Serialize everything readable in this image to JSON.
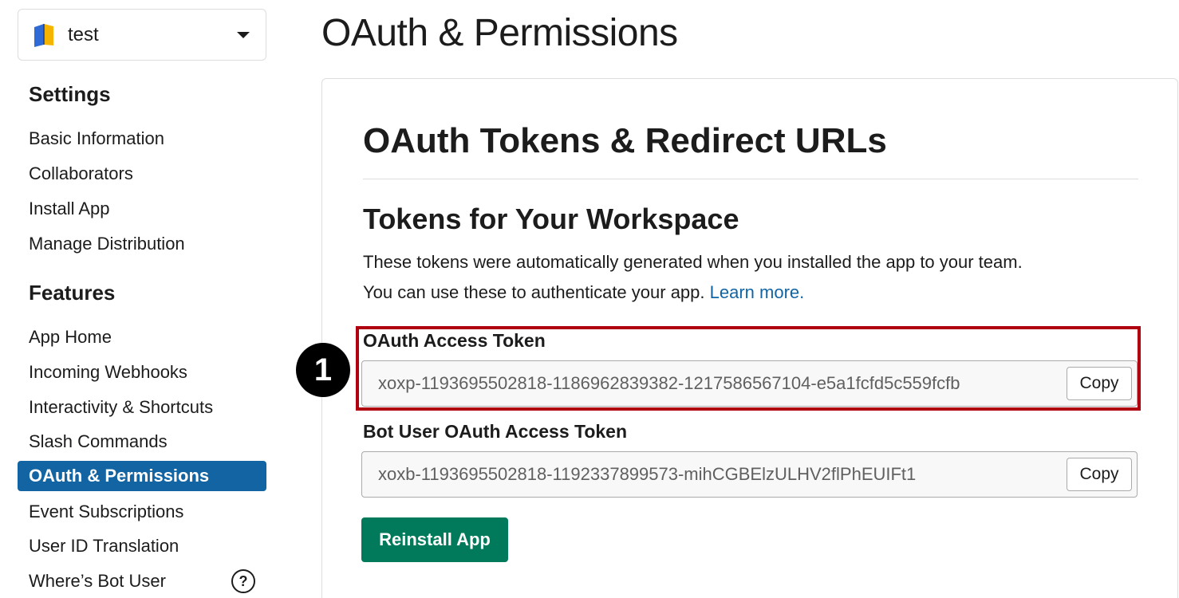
{
  "app_switcher": {
    "name": "test",
    "icon": "book-app-icon"
  },
  "sidebar": {
    "settings_heading": "Settings",
    "settings_items": [
      {
        "label": "Basic Information"
      },
      {
        "label": "Collaborators"
      },
      {
        "label": "Install App"
      },
      {
        "label": "Manage Distribution"
      }
    ],
    "features_heading": "Features",
    "features_items": [
      {
        "label": "App Home"
      },
      {
        "label": "Incoming Webhooks"
      },
      {
        "label": "Interactivity & Shortcuts"
      },
      {
        "label": "Slash Commands"
      },
      {
        "label": "OAuth & Permissions",
        "active": true
      },
      {
        "label": "Event Subscriptions"
      },
      {
        "label": "User ID Translation"
      },
      {
        "label": "Where’s Bot User"
      }
    ],
    "help_icon": "question-circle-icon"
  },
  "main": {
    "page_title": "OAuth & Permissions",
    "section_title": "OAuth Tokens & Redirect URLs",
    "sub_title": "Tokens for Your Workspace",
    "description_line1": "These tokens were automatically generated when you installed the app to your team.",
    "description_line2": "You can use these to authenticate your app.",
    "learn_more": "Learn more.",
    "step_number": "1",
    "oauth_token": {
      "label": "OAuth Access Token",
      "value": "xoxp-1193695502818-1186962839382-1217586567104-e5a1fcfd5c559fcfb",
      "copy_label": "Copy"
    },
    "bot_token": {
      "label": "Bot User OAuth Access Token",
      "value": "xoxb-1193695502818-1192337899573-mihCGBElzULHV2flPhEUIFt1",
      "copy_label": "Copy"
    },
    "reinstall_label": "Reinstall App"
  },
  "colors": {
    "accent_blue": "#1264a3",
    "reinstall_green": "#007a5a",
    "highlight_red": "#b00010"
  }
}
